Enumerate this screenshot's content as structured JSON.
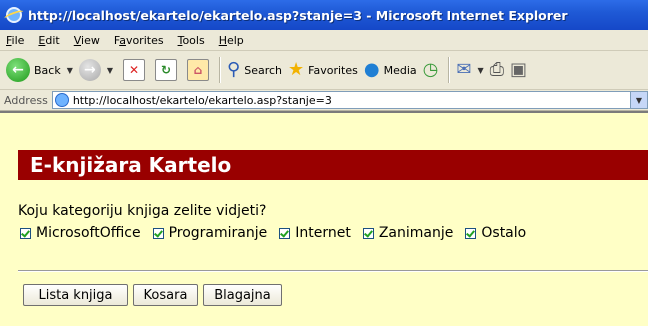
{
  "window": {
    "title": "http://localhost/ekartelo/ekartelo.asp?stanje=3 - Microsoft Internet Explorer"
  },
  "menu": {
    "items": [
      {
        "label": "File",
        "underline": "F",
        "rest": "ile"
      },
      {
        "label": "Edit",
        "underline": "E",
        "rest": "dit"
      },
      {
        "label": "View",
        "underline": "V",
        "rest": "iew"
      },
      {
        "label": "Favorites",
        "prefix": "F",
        "underline": "a",
        "rest": "vorites"
      },
      {
        "label": "Tools",
        "underline": "T",
        "rest": "ools"
      },
      {
        "label": "Help",
        "underline": "H",
        "rest": "elp"
      }
    ]
  },
  "toolbar": {
    "back_label": "Back",
    "search_label": "Search",
    "favorites_label": "Favorites",
    "media_label": "Media"
  },
  "addressbar": {
    "label": "Address",
    "url": "http://localhost/ekartelo/ekartelo.asp?stanje=3"
  },
  "page": {
    "banner": "E-knjižara Kartelo",
    "question": "Koju kategoriju knjiga zelite vidjeti?",
    "categories": [
      {
        "label": "MicrosoftOffice",
        "checked": true
      },
      {
        "label": "Programiranje",
        "checked": true
      },
      {
        "label": "Internet",
        "checked": true
      },
      {
        "label": "Zanimanje",
        "checked": true
      },
      {
        "label": "Ostalo",
        "checked": true
      }
    ],
    "buttons": {
      "lista": "Lista knjiga",
      "kosara": "Kosara",
      "blagajna": "Blagajna"
    }
  },
  "icons": [
    "ie-logo-icon",
    "back-arrow-icon",
    "forward-arrow-icon",
    "stop-icon",
    "refresh-icon",
    "home-icon",
    "search-icon",
    "favorites-star-icon",
    "media-icon",
    "history-icon",
    "mail-icon",
    "print-icon",
    "edit-icon",
    "page-icon"
  ],
  "colors": {
    "titlebar": "#1f5ad6",
    "banner": "#990000",
    "page_bg": "#ffffc6",
    "chrome": "#ece9d8"
  }
}
